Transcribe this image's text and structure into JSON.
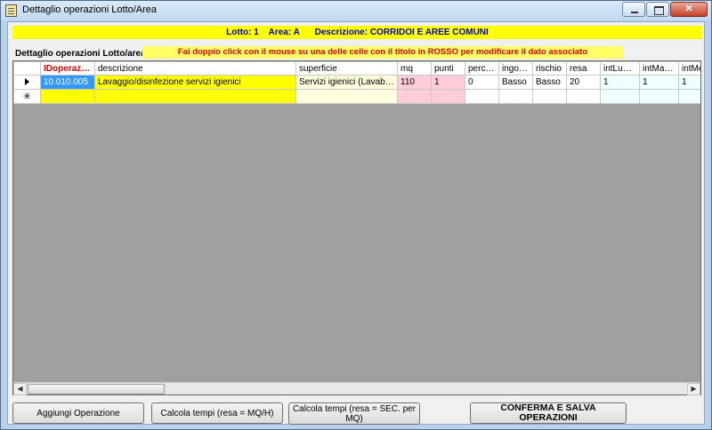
{
  "window": {
    "title": "Dettaglio operazioni Lotto/Area",
    "app_icon": "form-icon",
    "controls": [
      "minimize-icon",
      "maximize-icon",
      "close-icon"
    ]
  },
  "banner": {
    "lotto": "Lotto: 1",
    "area": "Area: A",
    "descrizione": "Descrizione: CORRIDOI E AREE COMUNI"
  },
  "section_label": "Dettaglio operazioni Lotto/area:",
  "hint": "Fai doppio click con il mouse su una delle celle con il titolo in ROSSO per modificare il dato associato",
  "grid": {
    "columns": [
      "IDoperazione",
      "descrizione",
      "superficie",
      "mq",
      "punti",
      "percVetri",
      "ingombro",
      "rischio",
      "resa",
      "intLunedì",
      "intMartedì",
      "intMercoledì"
    ],
    "rows": [
      [
        "10.010.005",
        "Lavaggio/disinfezione servizi igienici",
        "Servizi igienici (Lavabo, spe...",
        "110",
        "1",
        "0",
        "Basso",
        "Basso",
        "20",
        "1",
        "1",
        "1"
      ]
    ],
    "new_row_marker": "✳"
  },
  "buttons": {
    "add": "Aggiungi Operazione",
    "calc_mqh": "Calcola tempi (resa = MQ/H)",
    "calc_sec": "Calcola tempi (resa = SEC. per MQ)",
    "confirm": "CONFERMA E SALVA OPERAZIONI"
  },
  "colors": {
    "banner_bg": "#ffff00",
    "banner_text": "#0000c0",
    "hint_text": "#e00000",
    "selected_cell": "#3399ff",
    "grid_bg": "#a0a0a0"
  }
}
